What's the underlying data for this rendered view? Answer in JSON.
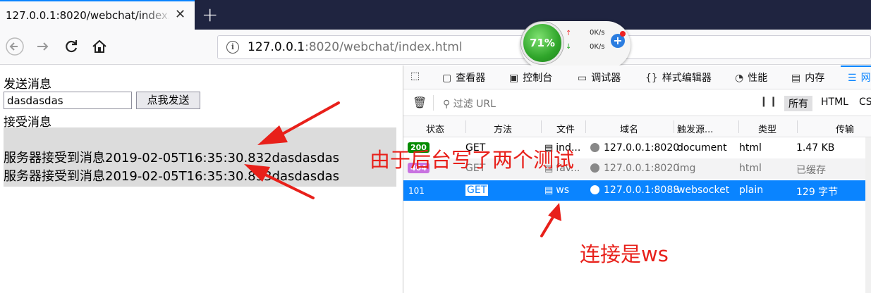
{
  "browser": {
    "tab_title": "127.0.0.1:8020/webchat/index.html",
    "tab_close": "✕",
    "newtab": "+",
    "url_host": "127.0.0.1",
    "url_rest": ":8020/webchat/index.html"
  },
  "speed_widget": {
    "percent": "71%",
    "up_rate": "0K/s",
    "down_rate": "0K/s",
    "plus": "+"
  },
  "page": {
    "send_label": "发送消息",
    "input_value": "dasdasdas",
    "send_button": "点我发送",
    "recv_label": "接受消息",
    "messages": [
      "服务器接受到消息2019-02-05T16:35:30.832dasdasdas",
      "服务器接受到消息2019-02-05T16:35:30.833dasdasdas"
    ]
  },
  "devtools": {
    "tabs": [
      "查看器",
      "控制台",
      "调试器",
      "样式编辑器",
      "性能",
      "内存",
      "网"
    ],
    "filter_placeholder": "过滤 URL",
    "type_filters": [
      "所有",
      "HTML",
      "CSS"
    ],
    "columns": [
      "状态",
      "方法",
      "文件",
      "域名",
      "触发源...",
      "类型",
      "传输"
    ],
    "requests": [
      {
        "status": "200",
        "method": "GET",
        "file": "ind...",
        "domain": "127.0.0.1:8020",
        "cause": "document",
        "type": "html",
        "transferred": "1.47 KB"
      },
      {
        "status": "404",
        "method": "GET",
        "file": "fav...",
        "domain": "127.0.0.1:8020",
        "cause": "img",
        "type": "html",
        "transferred": "已缓存"
      },
      {
        "status": "101",
        "method": "GET",
        "file": "ws",
        "domain": "127.0.0.1:8088",
        "cause": "websocket",
        "type": "plain",
        "transferred": "129 字节"
      }
    ]
  },
  "annotations": {
    "note1": "由于后台写了两个测试",
    "note2": "连接是ws"
  },
  "colors": {
    "accent": "#0a84ff",
    "annotation_red": "#e8201a",
    "status_ok": "#058b00"
  }
}
